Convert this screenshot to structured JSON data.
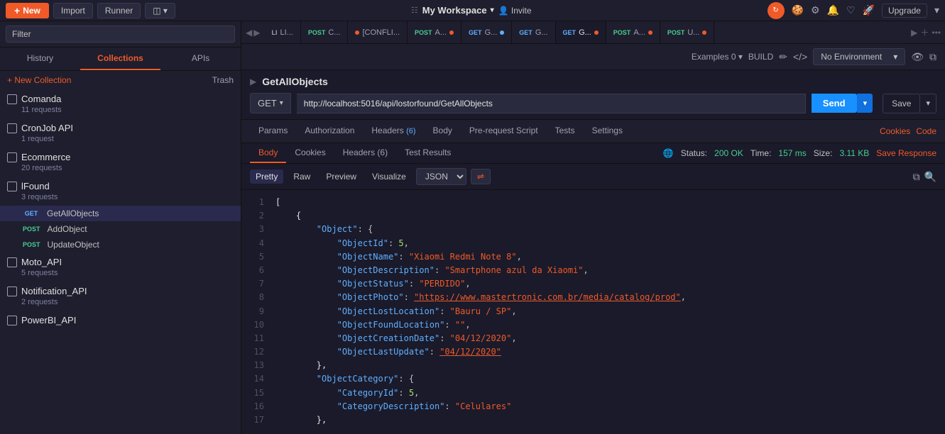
{
  "topbar": {
    "new_label": "New",
    "import_label": "Import",
    "runner_label": "Runner",
    "workspace_label": "My Workspace",
    "invite_label": "Invite",
    "upgrade_label": "Upgrade",
    "env_label": "No Environment"
  },
  "sidebar": {
    "search_placeholder": "Filter",
    "tabs": [
      "History",
      "Collections",
      "APIs"
    ],
    "active_tab": "Collections",
    "new_collection_label": "+ New Collection",
    "trash_label": "Trash",
    "collections": [
      {
        "name": "Comanda",
        "meta": "11 requests"
      },
      {
        "name": "CronJob API",
        "meta": "1 request"
      },
      {
        "name": "Ecommerce",
        "meta": "20 requests"
      },
      {
        "name": "lFound",
        "meta": "3 requests",
        "expanded": true
      },
      {
        "name": "Moto_API",
        "meta": "5 requests"
      },
      {
        "name": "Notification_API",
        "meta": "2 requests"
      },
      {
        "name": "PowerBI_API",
        "meta": ""
      }
    ],
    "requests": [
      {
        "method": "GET",
        "name": "GetAllObjects",
        "active": true
      },
      {
        "method": "POST",
        "name": "AddObject"
      },
      {
        "method": "POST",
        "name": "UpdateObject"
      }
    ]
  },
  "tabs_bar": {
    "tabs": [
      {
        "method": "LI",
        "name": "LI...",
        "dot": "none",
        "active": false
      },
      {
        "method": "POST",
        "name": "POST C...",
        "dot": "none",
        "active": false
      },
      {
        "method": "CONFLI",
        "name": "[CONFLI...",
        "dot": "orange",
        "active": false
      },
      {
        "method": "POST",
        "name": "POST A...",
        "dot": "orange",
        "active": false
      },
      {
        "method": "GET",
        "name": "GET G...",
        "dot": "blue",
        "active": false
      },
      {
        "method": "GET",
        "name": "GET G...",
        "dot": "none",
        "active": false
      },
      {
        "method": "GET",
        "name": "GET G...",
        "dot": "orange",
        "active": true
      },
      {
        "method": "POST",
        "name": "POST A...",
        "dot": "orange",
        "active": false
      },
      {
        "method": "POST",
        "name": "POST U...",
        "dot": "orange",
        "active": false
      }
    ]
  },
  "request": {
    "title": "GetAllObjects",
    "method": "GET",
    "url": "http://localhost:5016/api/lostorfound/GetAllObjects",
    "send_label": "Send",
    "save_label": "Save"
  },
  "nav_tabs": {
    "tabs": [
      "Params",
      "Authorization",
      "Headers (6)",
      "Body",
      "Pre-request Script",
      "Tests",
      "Settings"
    ],
    "active": "Body",
    "cookies_label": "Cookies",
    "code_label": "Code"
  },
  "response_tabs": {
    "tabs": [
      "Body",
      "Cookies",
      "Headers (6)",
      "Test Results"
    ],
    "active": "Body",
    "status": "200 OK",
    "time": "157 ms",
    "size": "3.11 KB",
    "save_response_label": "Save Response"
  },
  "response_toolbar": {
    "views": [
      "Pretty",
      "Raw",
      "Preview",
      "Visualize"
    ],
    "active_view": "Pretty",
    "format": "JSON"
  },
  "code_lines": [
    {
      "num": 1,
      "content": "[",
      "type": "bracket"
    },
    {
      "num": 2,
      "content": "    {",
      "type": "bracket"
    },
    {
      "num": 3,
      "content": "        \"Object\": {",
      "type": "key"
    },
    {
      "num": 4,
      "content": "            \"ObjectId\": 5,",
      "type": "mixed"
    },
    {
      "num": 5,
      "content": "            \"ObjectName\": \"Xiaomi Redmi Note 8\",",
      "type": "mixed"
    },
    {
      "num": 6,
      "content": "            \"ObjectDescription\": \"Smartphone azul da Xiaomi\",",
      "type": "mixed"
    },
    {
      "num": 7,
      "content": "            \"ObjectStatus\": \"PERDIDO\",",
      "type": "mixed"
    },
    {
      "num": 8,
      "content": "            \"ObjectPhoto\": \"https://www.mastertronic.com.br/media/catalog/prod\",",
      "type": "mixed"
    },
    {
      "num": 9,
      "content": "            \"ObjectLostLocation\": \"Bauru / SP\",",
      "type": "mixed"
    },
    {
      "num": 10,
      "content": "            \"ObjectFoundLocation\": \"\",",
      "type": "mixed"
    },
    {
      "num": 11,
      "content": "            \"ObjectCreationDate\": \"04/12/2020\",",
      "type": "mixed"
    },
    {
      "num": 12,
      "content": "            \"ObjectLastUpdate\": \"04/12/2020\"",
      "type": "mixed"
    },
    {
      "num": 13,
      "content": "        },",
      "type": "bracket"
    },
    {
      "num": 14,
      "content": "        \"ObjectCategory\": {",
      "type": "key"
    },
    {
      "num": 15,
      "content": "            \"CategoryId\": 5,",
      "type": "mixed"
    },
    {
      "num": 16,
      "content": "            \"CategoryDescription\": \"Celulares\"",
      "type": "mixed"
    },
    {
      "num": 17,
      "content": "        },",
      "type": "bracket"
    }
  ]
}
